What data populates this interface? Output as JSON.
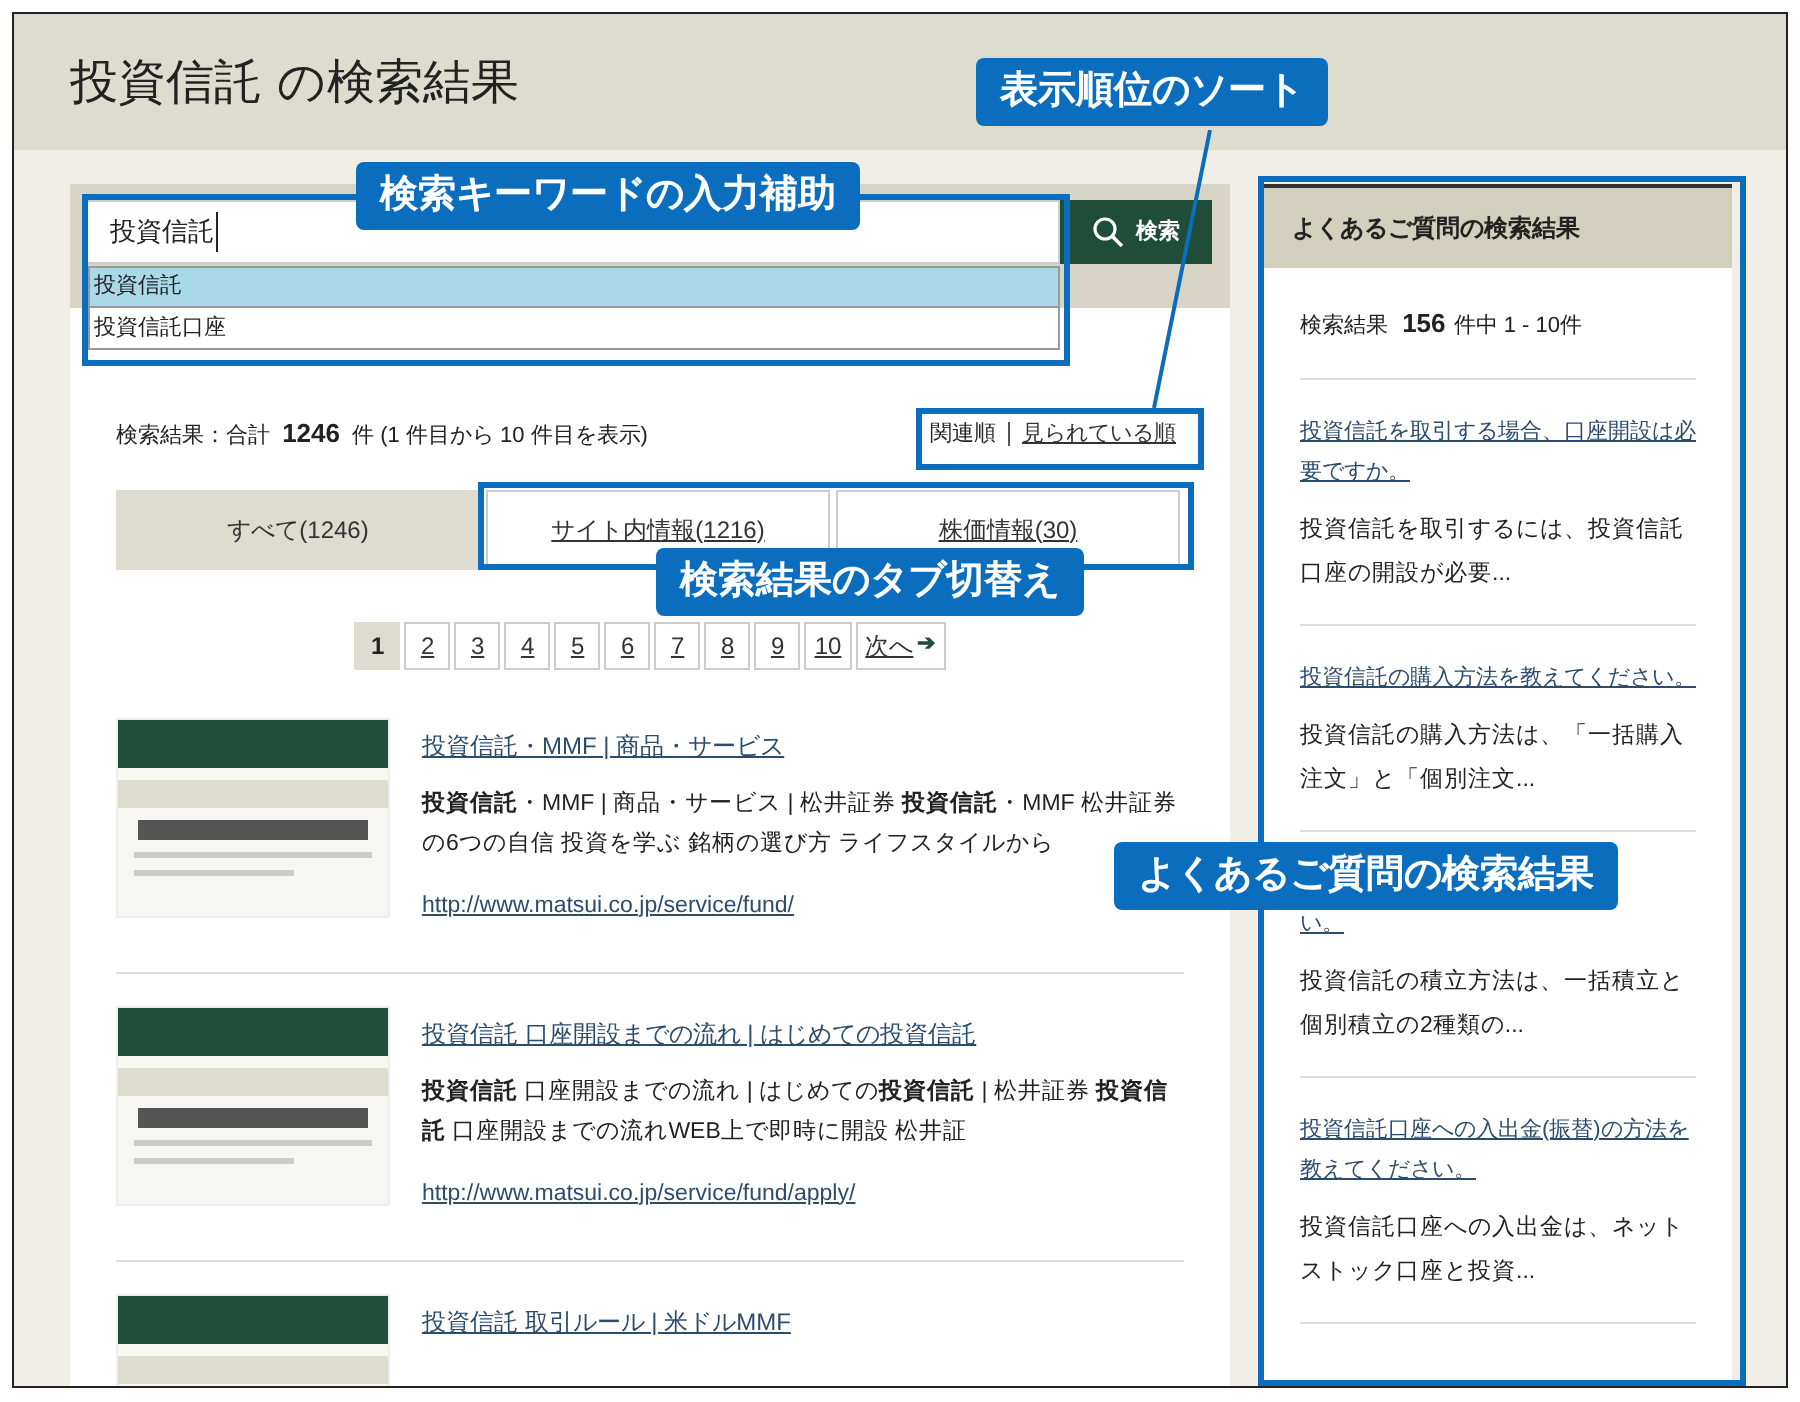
{
  "page_title": "投資信託 の検索結果",
  "search": {
    "value": "投資信託",
    "button": "検索",
    "suggestions": [
      {
        "text": "投資信託",
        "selected": true
      },
      {
        "text": "投資信託口座",
        "selected": false
      }
    ]
  },
  "summary": {
    "before": "検索結果：合計",
    "count": "1246",
    "after": "件 (1 件目から 10 件目を表示)"
  },
  "sort_options": [
    {
      "label": "関連順",
      "selected": true
    },
    {
      "label": "見られている順",
      "selected": false
    }
  ],
  "tabs": [
    {
      "label": "すべて(1246)",
      "selected": true
    },
    {
      "label": "サイト内情報(1216)",
      "selected": false
    },
    {
      "label": "株価情報(30)",
      "selected": false
    }
  ],
  "pagination": {
    "pages": [
      {
        "label": "1",
        "selected": true
      },
      {
        "label": "2",
        "selected": false
      },
      {
        "label": "3",
        "selected": false
      },
      {
        "label": "4",
        "selected": false
      },
      {
        "label": "5",
        "selected": false
      },
      {
        "label": "6",
        "selected": false
      },
      {
        "label": "7",
        "selected": false
      },
      {
        "label": "8",
        "selected": false
      },
      {
        "label": "9",
        "selected": false
      },
      {
        "label": "10",
        "selected": false
      }
    ],
    "next": "次へ",
    "next_icon": "➔"
  },
  "results": [
    {
      "title": "投資信託・MMF | 商品・サービス",
      "snippet": "**投資信託**・MMF | 商品・サービス | 松井証券 **投資信託**・MMF 松井証券の6つの自信 投資を学ぶ 銘柄の選び方 ライフスタイルから",
      "url": "http://www.matsui.co.jp/service/fund/"
    },
    {
      "title": "投資信託 口座開設までの流れ | はじめての投資信託",
      "snippet": "**投資信託** 口座開設までの流れ | はじめての**投資信託** | 松井証券 **投資信託** 口座開設までの流れWEB上で即時に開設 松井証",
      "url": "http://www.matsui.co.jp/service/fund/apply/"
    },
    {
      "title": "投資信託 取引ルール | 米ドルMMF"
    }
  ],
  "faq": {
    "heading": "よくあるご質問の検索結果",
    "summary_before": "検索結果",
    "count": "156",
    "summary_after": "件中 1 - 10件",
    "items": [
      {
        "title": "投資信託を取引する場合、口座開設は必要ですか。",
        "snippet": "投資信託を取引するには、投資信託口座の開設が必要..."
      },
      {
        "title": "投資信託の購入方法を教えてください。",
        "snippet": "投資信託の購入方法は、「一括購入注文」と「個別注文..."
      },
      {
        "title": "い。",
        "snippet": "投資信託の積立方法は、一括積立と個別積立の2種類の..."
      },
      {
        "title": "投資信託口座への入出金(振替)の方法を教えてください。",
        "snippet": "投資信託口座への入出金は、ネットストック口座と投資..."
      }
    ]
  },
  "annotations": [
    {
      "text": "表示順位のソート"
    },
    {
      "text": "検索キーワードの入力補助"
    },
    {
      "text": "検索結果のタブ切替え"
    },
    {
      "text": "よくあるご質問の検索結果"
    }
  ]
}
